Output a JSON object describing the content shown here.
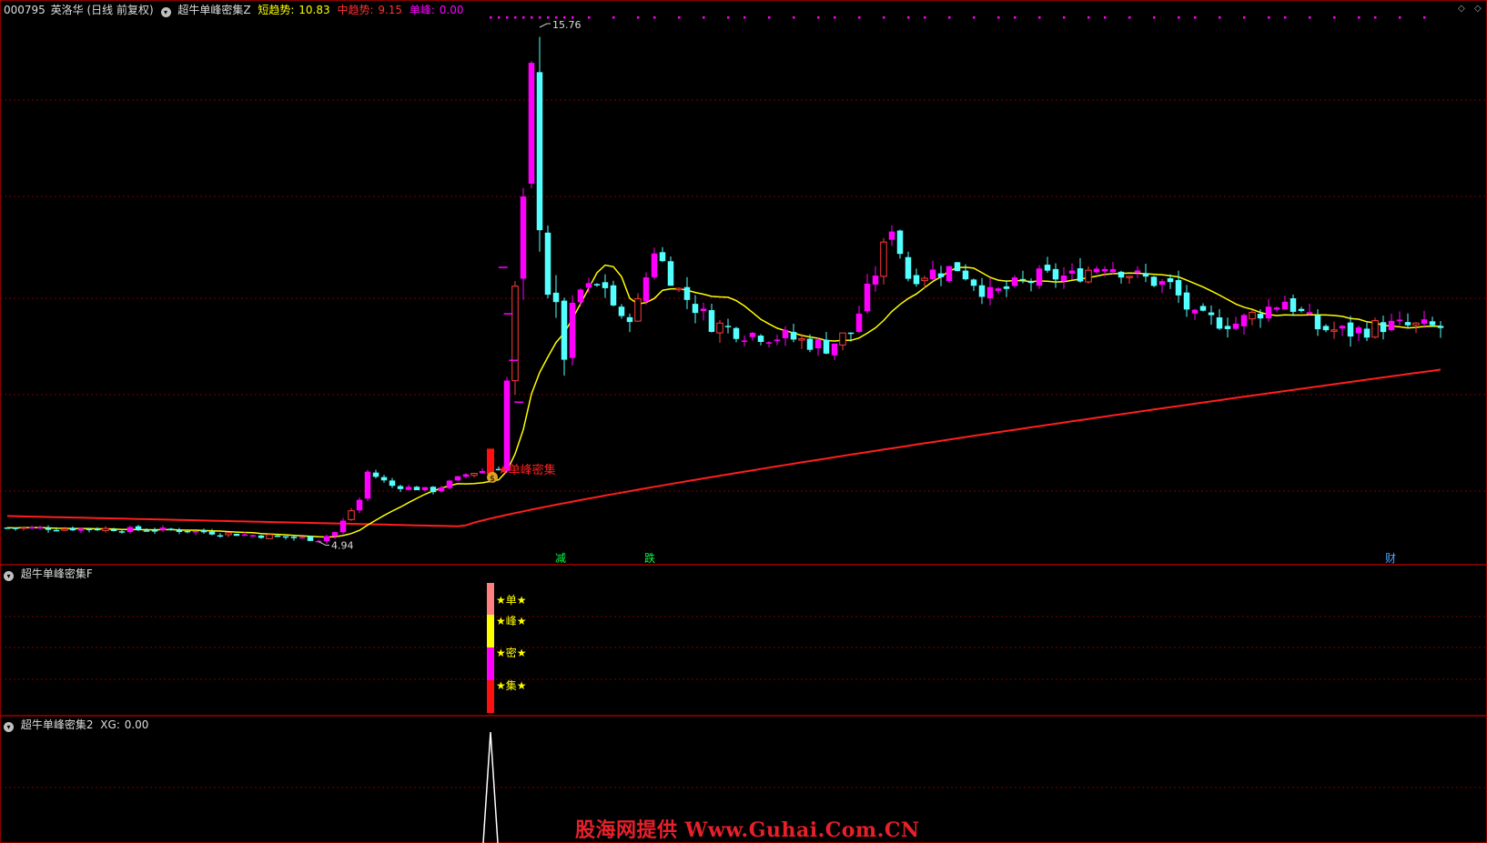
{
  "main_header": {
    "code": "000795",
    "name": "英洛华",
    "period": "(日线 前复权)",
    "indicator": "超牛单峰密集Z",
    "short_label": "短趋势:",
    "short_value": "10.83",
    "mid_label": "中趋势:",
    "mid_value": "9.15",
    "peak_label": "单峰:",
    "peak_value": "0.00"
  },
  "panel2_header": {
    "name": "超牛单峰密集F"
  },
  "panel3_header": {
    "name": "超牛单峰密集2",
    "xg_label": "XG:",
    "xg_value": "0.00"
  },
  "annotations": {
    "high": "15.76",
    "low": "4.94",
    "signal": "★单峰密集",
    "mark1": "减",
    "mark2": "跌",
    "mark3": "财",
    "star1": "★单★",
    "star2": "★峰★",
    "star3": "★密★",
    "star4": "★集★"
  },
  "watermark": "股海网提供 Www.Guhai.Com.CN",
  "colors": {
    "bg": "#000000",
    "up": "#ff00ff",
    "up_outline": "#ff3b3b",
    "down": "#54ffff",
    "ma_short": "#ffff00",
    "ma_mid": "#ff1e1e",
    "grid": "#7a0000",
    "signal": "#ff2020"
  },
  "chart_data": {
    "type": "candlestick",
    "y_range": [
      4.5,
      16.2
    ],
    "high_value": 15.76,
    "low_value": 4.94,
    "signal_bar_index": 59,
    "indicator2_bar_index": 59
  }
}
